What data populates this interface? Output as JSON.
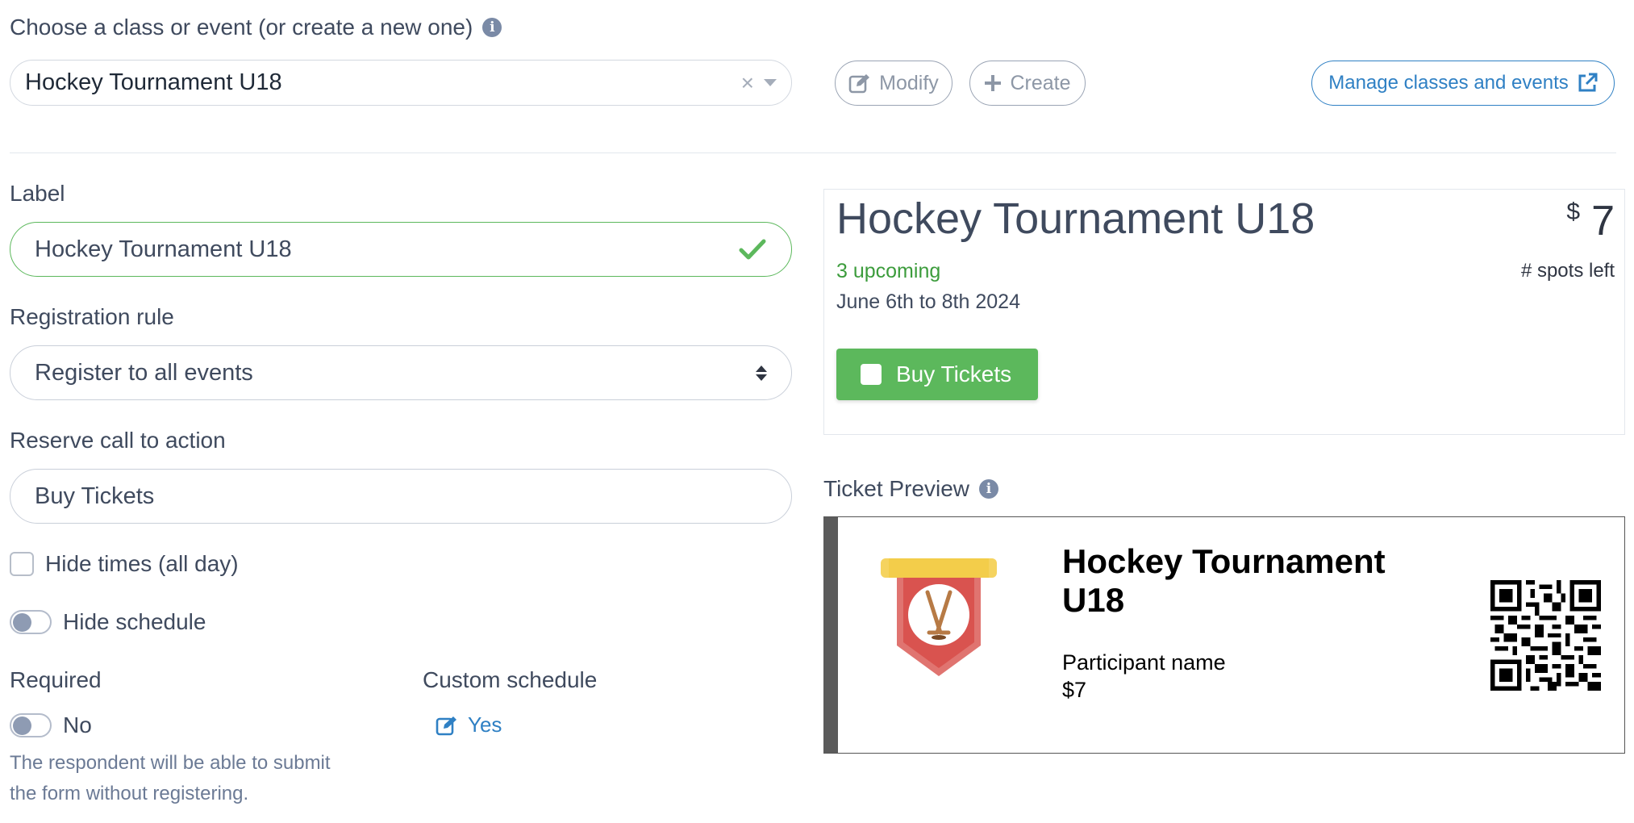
{
  "top": {
    "choose_label": "Choose a class or event (or create a new one)",
    "selected_event": "Hockey Tournament U18",
    "clear_symbol": "×",
    "modify_label": "Modify",
    "create_label": "Create",
    "manage_label": "Manage classes and events"
  },
  "form": {
    "label_title": "Label",
    "label_value": "Hockey Tournament U18",
    "registration_rule_title": "Registration rule",
    "registration_rule_value": "Register to all events",
    "reserve_cta_title": "Reserve call to action",
    "reserve_cta_value": "Buy Tickets",
    "hide_times_label": "Hide times (all day)",
    "hide_schedule_label": "Hide schedule",
    "required_title": "Required",
    "required_value": "No",
    "required_help_line1": "The respondent will be able to submit",
    "required_help_line2": "the form without registering.",
    "custom_schedule_title": "Custom schedule",
    "custom_schedule_value": "Yes"
  },
  "event_preview": {
    "title": "Hockey Tournament U18",
    "currency": "$",
    "price": "7",
    "upcoming": "3 upcoming",
    "spots_left": "# spots left",
    "dates": "June 6th to 8th 2024",
    "button_label": "Buy Tickets"
  },
  "ticket_preview": {
    "section_label": "Ticket Preview",
    "title": "Hockey Tournament U18",
    "participant_label": "Participant name",
    "price": "$7"
  },
  "colors": {
    "accent_blue": "#2f80c4",
    "success_green": "#5cb85c",
    "text": "#3f4a5e"
  },
  "icons": {
    "info": "info-icon",
    "modify": "edit-icon",
    "create": "plus-icon",
    "manage": "external-link-icon",
    "valid": "check-icon",
    "ticket": "hockey-pennant-icon",
    "qr": "qr-code-icon"
  }
}
